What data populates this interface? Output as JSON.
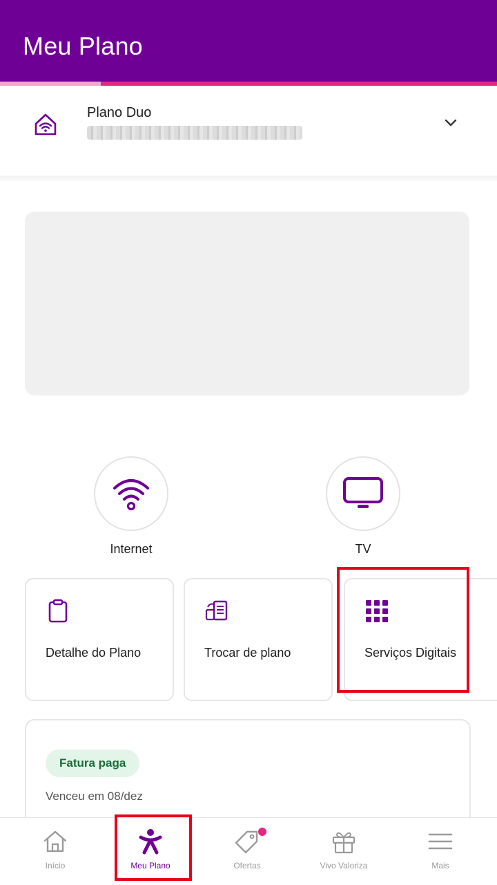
{
  "header": {
    "title": "Meu Plano",
    "bg_color": "#6f0096",
    "accent_color": "#e6277f"
  },
  "plan": {
    "name": "Plano Duo",
    "icon": "wifi-home-icon",
    "chevron": "chevron-down-icon"
  },
  "services": [
    {
      "label": "Internet",
      "icon": "wifi-icon"
    },
    {
      "label": "TV",
      "icon": "tv-icon"
    }
  ],
  "tiles": [
    {
      "label": "Detalhe do Plano",
      "icon": "clipboard-icon"
    },
    {
      "label": "Trocar de plano",
      "icon": "swap-document-icon"
    },
    {
      "label": "Serviços Digitais",
      "icon": "grid-icon"
    }
  ],
  "invoice": {
    "status": "Fatura paga",
    "due_text": "Venceu em 08/dez",
    "status_color": "#1a6b3a"
  },
  "bottom_nav": [
    {
      "label": "Início",
      "icon": "home-icon",
      "active": false
    },
    {
      "label": "Meu Plano",
      "icon": "vivo-person-icon",
      "active": true
    },
    {
      "label": "Ofertas",
      "icon": "tag-icon",
      "active": false,
      "badge": true
    },
    {
      "label": "Vivo Valoriza",
      "icon": "gift-icon",
      "active": false
    },
    {
      "label": "Mais",
      "icon": "menu-icon",
      "active": false
    }
  ]
}
